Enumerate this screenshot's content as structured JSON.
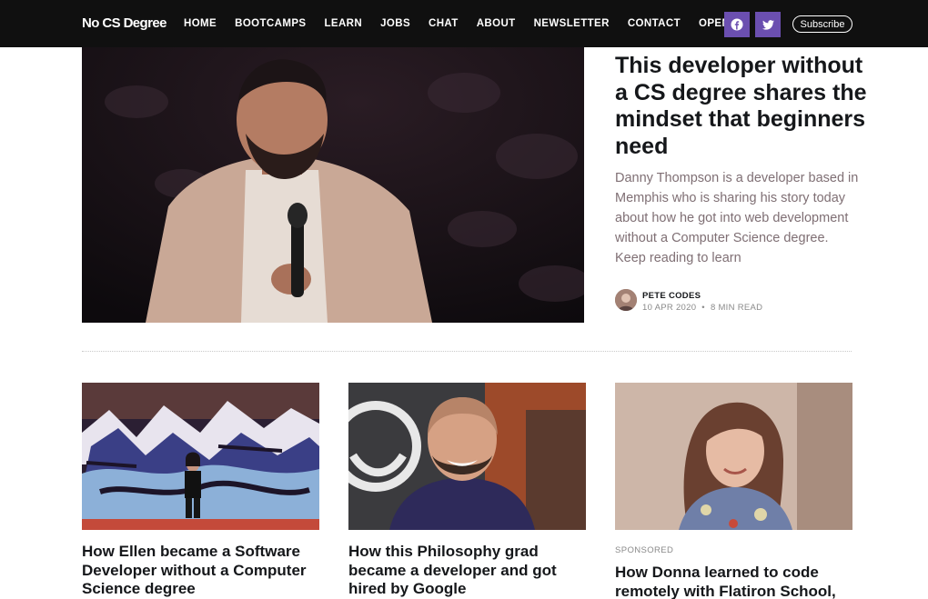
{
  "nav": {
    "brand": "No CS Degree",
    "links": [
      "HOME",
      "BOOTCAMPS",
      "LEARN",
      "JOBS",
      "CHAT",
      "ABOUT",
      "NEWSLETTER",
      "CONTACT",
      "OPEN"
    ],
    "subscribe": "Subscribe",
    "social": {
      "facebook_icon": "facebook-icon",
      "twitter_icon": "twitter-icon"
    }
  },
  "featured": {
    "title": "This developer without a CS degree shares the mindset that beginners need",
    "excerpt": "Danny Thompson is a developer based in Memphis who is sharing his story today about how he got into web development without a Computer Science degree. Keep reading to learn",
    "author": "PETE CODES",
    "date": "10 APR 2020",
    "separator": "•",
    "read_time": "8 MIN READ"
  },
  "cards": [
    {
      "title": "How Ellen became a Software Developer without a Computer Science degree",
      "label": ""
    },
    {
      "title": "How this Philosophy grad became a developer and got hired by Google",
      "label": ""
    },
    {
      "title": "How Donna learned to code remotely with Flatiron School,",
      "label": "SPONSORED"
    }
  ],
  "colors": {
    "nav_bg": "#101010",
    "social_bg": "#6b4fb0",
    "excerpt": "#7f6f74"
  }
}
